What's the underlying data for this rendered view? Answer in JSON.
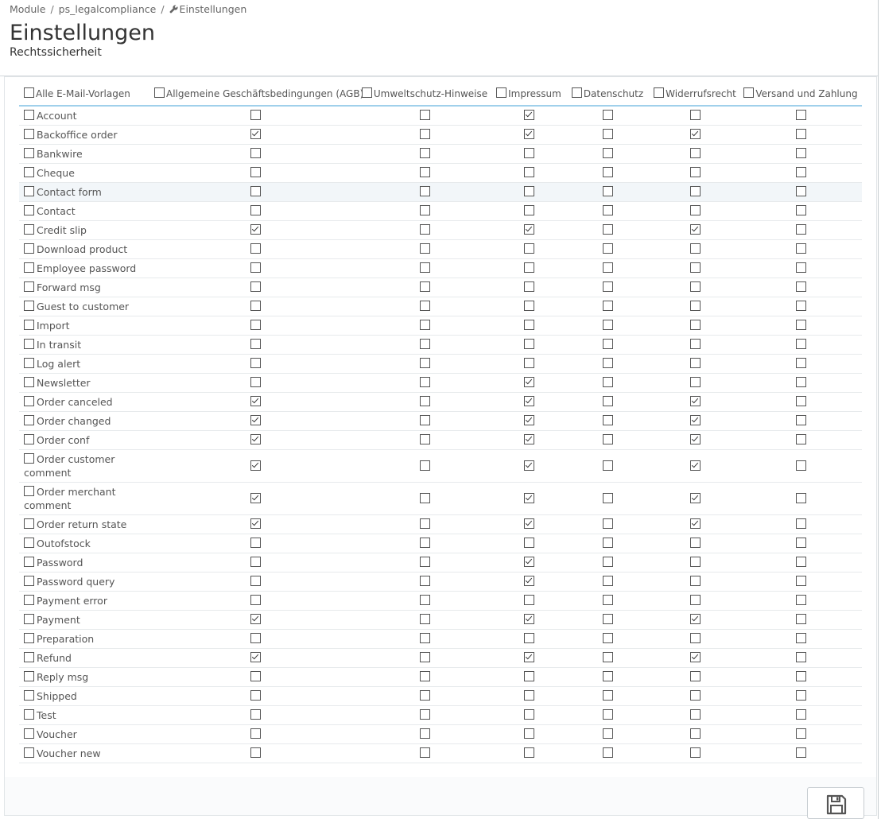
{
  "breadcrumb": {
    "items": [
      "Module",
      "ps_legalcompliance",
      "Einstellungen"
    ],
    "separator": "/"
  },
  "page": {
    "title": "Einstellungen",
    "subtitle": "Rechtssicherheit"
  },
  "table": {
    "columns": [
      "Alle E-Mail-Vorlagen",
      "Allgemeine Geschäftsbedingungen (AGB)",
      "Umweltschutz-Hinweise",
      "Impressum",
      "Datenschutz",
      "Widerrufsrecht",
      "Versand und Zahlung"
    ],
    "rows": [
      {
        "name": "Account",
        "checks": [
          false,
          false,
          true,
          false,
          false,
          false
        ]
      },
      {
        "name": "Backoffice order",
        "checks": [
          true,
          false,
          true,
          false,
          true,
          false
        ]
      },
      {
        "name": "Bankwire",
        "checks": [
          false,
          false,
          false,
          false,
          false,
          false
        ]
      },
      {
        "name": "Cheque",
        "checks": [
          false,
          false,
          false,
          false,
          false,
          false
        ]
      },
      {
        "name": "Contact form",
        "checks": [
          false,
          false,
          false,
          false,
          false,
          false
        ]
      },
      {
        "name": "Contact",
        "checks": [
          false,
          false,
          false,
          false,
          false,
          false
        ]
      },
      {
        "name": "Credit slip",
        "checks": [
          true,
          false,
          true,
          false,
          true,
          false
        ]
      },
      {
        "name": "Download product",
        "checks": [
          false,
          false,
          false,
          false,
          false,
          false
        ]
      },
      {
        "name": "Employee password",
        "checks": [
          false,
          false,
          false,
          false,
          false,
          false
        ]
      },
      {
        "name": "Forward msg",
        "checks": [
          false,
          false,
          false,
          false,
          false,
          false
        ]
      },
      {
        "name": "Guest to customer",
        "checks": [
          false,
          false,
          false,
          false,
          false,
          false
        ]
      },
      {
        "name": "Import",
        "checks": [
          false,
          false,
          false,
          false,
          false,
          false
        ]
      },
      {
        "name": "In transit",
        "checks": [
          false,
          false,
          false,
          false,
          false,
          false
        ]
      },
      {
        "name": "Log alert",
        "checks": [
          false,
          false,
          false,
          false,
          false,
          false
        ]
      },
      {
        "name": "Newsletter",
        "checks": [
          false,
          false,
          true,
          false,
          false,
          false
        ]
      },
      {
        "name": "Order canceled",
        "checks": [
          true,
          false,
          true,
          false,
          true,
          false
        ]
      },
      {
        "name": "Order changed",
        "checks": [
          true,
          false,
          true,
          false,
          true,
          false
        ]
      },
      {
        "name": "Order conf",
        "checks": [
          true,
          false,
          true,
          false,
          true,
          false
        ]
      },
      {
        "name": "Order customer comment",
        "checks": [
          true,
          false,
          true,
          false,
          true,
          false
        ]
      },
      {
        "name": "Order merchant comment",
        "checks": [
          true,
          false,
          true,
          false,
          true,
          false
        ]
      },
      {
        "name": "Order return state",
        "checks": [
          true,
          false,
          true,
          false,
          true,
          false
        ]
      },
      {
        "name": "Outofstock",
        "checks": [
          false,
          false,
          false,
          false,
          false,
          false
        ]
      },
      {
        "name": "Password",
        "checks": [
          false,
          false,
          true,
          false,
          false,
          false
        ]
      },
      {
        "name": "Password query",
        "checks": [
          false,
          false,
          true,
          false,
          false,
          false
        ]
      },
      {
        "name": "Payment error",
        "checks": [
          false,
          false,
          false,
          false,
          false,
          false
        ]
      },
      {
        "name": "Payment",
        "checks": [
          true,
          false,
          true,
          false,
          true,
          false
        ]
      },
      {
        "name": "Preparation",
        "checks": [
          false,
          false,
          false,
          false,
          false,
          false
        ]
      },
      {
        "name": "Refund",
        "checks": [
          true,
          false,
          true,
          false,
          true,
          false
        ]
      },
      {
        "name": "Reply msg",
        "checks": [
          false,
          false,
          false,
          false,
          false,
          false
        ]
      },
      {
        "name": "Shipped",
        "checks": [
          false,
          false,
          false,
          false,
          false,
          false
        ]
      },
      {
        "name": "Test",
        "checks": [
          false,
          false,
          false,
          false,
          false,
          false
        ]
      },
      {
        "name": "Voucher",
        "checks": [
          false,
          false,
          false,
          false,
          false,
          false
        ]
      },
      {
        "name": "Voucher new",
        "checks": [
          false,
          false,
          false,
          false,
          false,
          false
        ]
      }
    ]
  },
  "footer": {
    "save_icon": "floppy-disk-icon"
  }
}
